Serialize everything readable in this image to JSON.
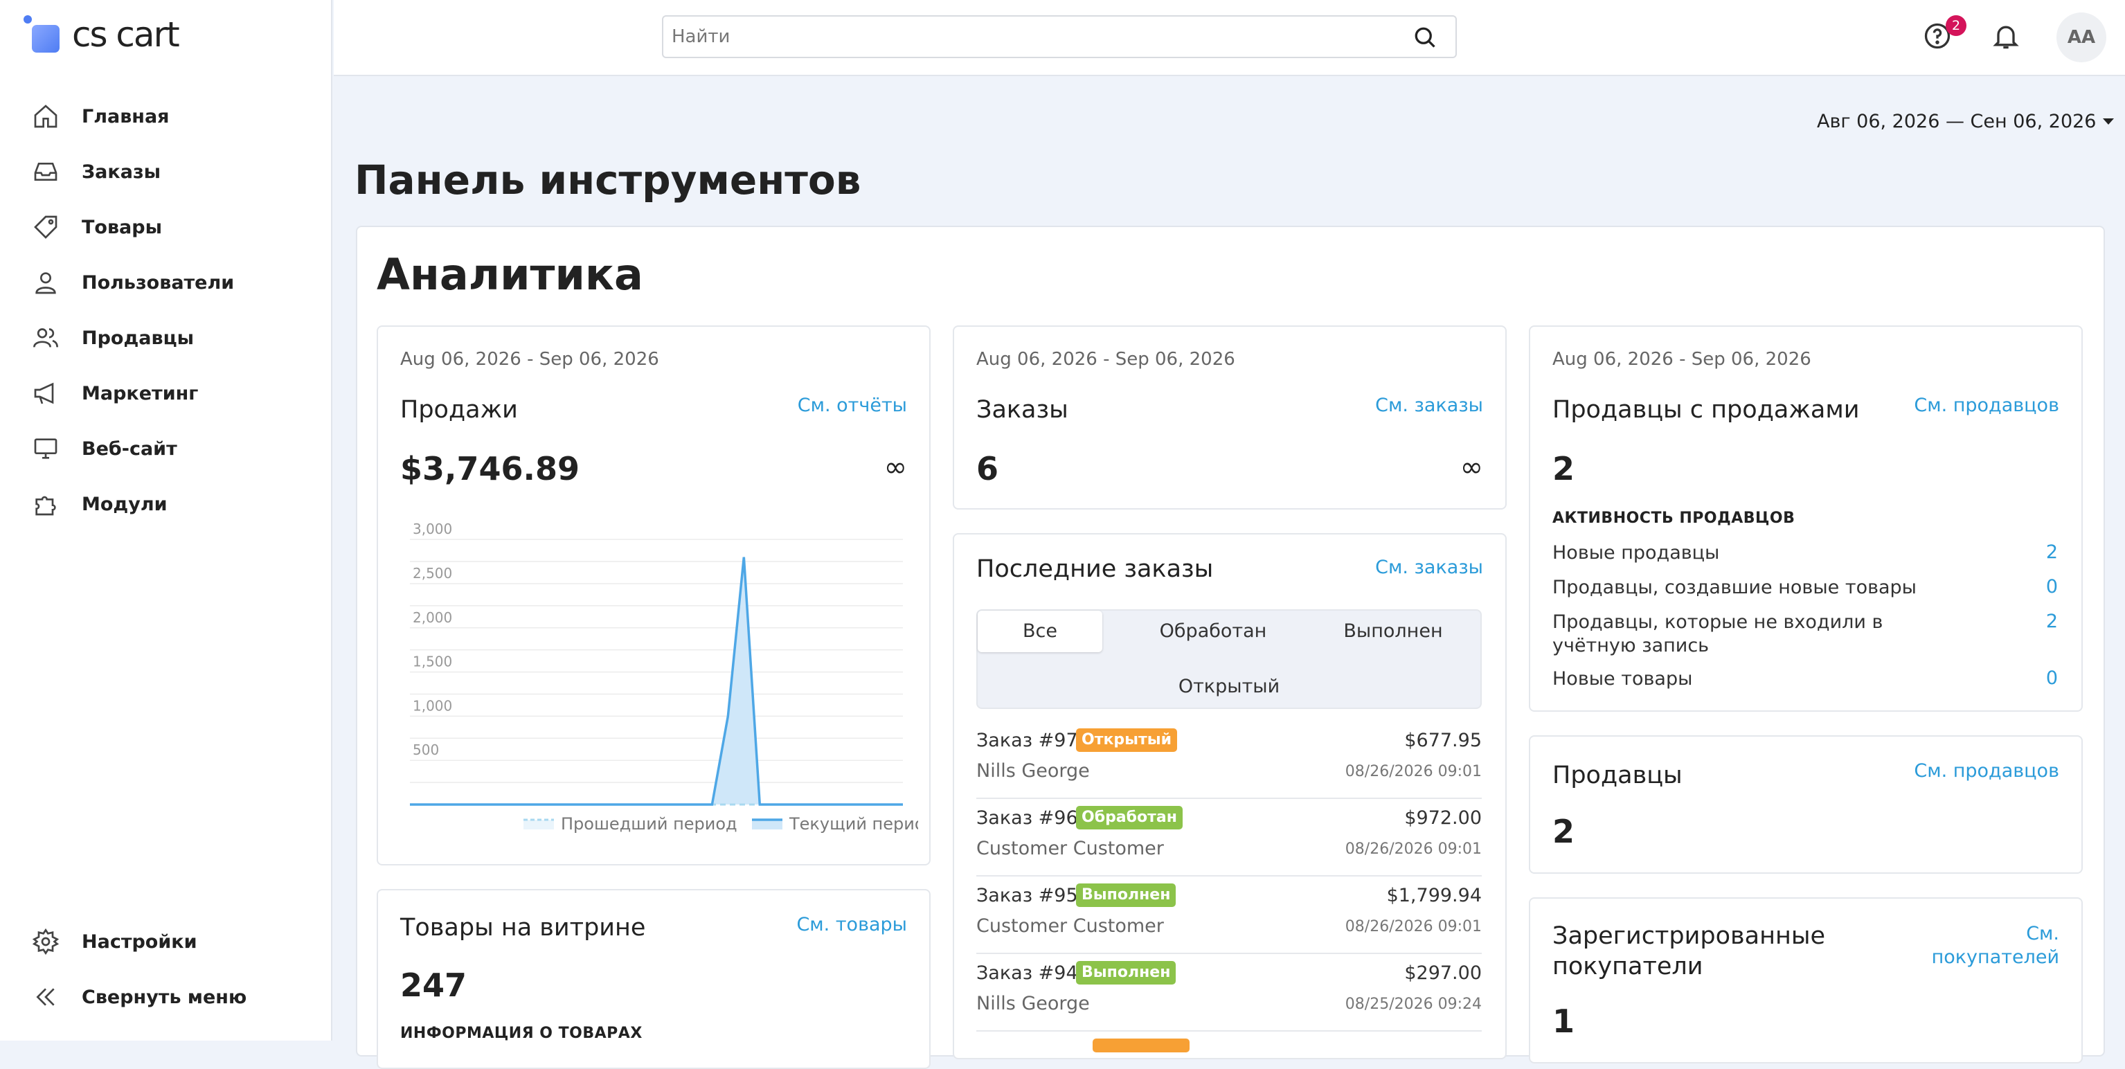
{
  "app": {
    "logo_text": "cs cart"
  },
  "sidebar": {
    "items": [
      {
        "label": "Главная",
        "icon": "home-icon"
      },
      {
        "label": "Заказы",
        "icon": "inbox-icon"
      },
      {
        "label": "Товары",
        "icon": "tag-icon"
      },
      {
        "label": "Пользователи",
        "icon": "user-icon"
      },
      {
        "label": "Продавцы",
        "icon": "users-icon"
      },
      {
        "label": "Маркетинг",
        "icon": "megaphone-icon"
      },
      {
        "label": "Веб-сайт",
        "icon": "monitor-icon"
      },
      {
        "label": "Модули",
        "icon": "puzzle-icon"
      }
    ],
    "settings_label": "Настройки",
    "collapse_label": "Свернуть меню"
  },
  "topbar": {
    "search_placeholder": "Найти",
    "help_badge": "2",
    "avatar_initials": "AA"
  },
  "page": {
    "date_range": "Авг 06, 2026 — Сен 06, 2026",
    "title": "Панель инструментов",
    "section_title": "Аналитика"
  },
  "sales": {
    "date": "Aug 06, 2026 - Sep 06, 2026",
    "title": "Продажи",
    "link": "См. отчёты",
    "value": "$3,746.89",
    "change": "∞"
  },
  "chart_data": {
    "type": "area",
    "ylim": [
      0,
      3000
    ],
    "yticks": [
      "500",
      "1,000",
      "1,500",
      "2,000",
      "2,500",
      "3,000"
    ],
    "points": 32,
    "series": [
      {
        "name": "Прошедший период",
        "values": [
          0,
          0,
          0,
          0,
          0,
          0,
          0,
          0,
          0,
          0,
          0,
          0,
          0,
          0,
          0,
          0,
          0,
          0,
          0,
          0,
          0,
          0,
          0,
          0,
          0,
          0,
          0,
          0,
          0,
          0,
          0,
          0
        ]
      },
      {
        "name": "Текущий период",
        "values": [
          0,
          0,
          0,
          0,
          0,
          0,
          0,
          0,
          0,
          0,
          0,
          0,
          0,
          0,
          0,
          0,
          0,
          0,
          0,
          0,
          1000,
          2800,
          0,
          0,
          0,
          0,
          0,
          0,
          0,
          0,
          0,
          0
        ]
      }
    ],
    "colors": {
      "past": "#a8d8f0",
      "current": "#4ea7e6",
      "fill": "#cfe7f9"
    }
  },
  "orders": {
    "date": "Aug 06, 2026 - Sep 06, 2026",
    "title": "Заказы",
    "link": "См. заказы",
    "value": "6",
    "change": "∞"
  },
  "recent_orders": {
    "title": "Последние заказы",
    "link": "См. заказы",
    "tabs": [
      "Все",
      "Обработан",
      "Выполнен",
      "Открытый"
    ],
    "rows": [
      {
        "no": "Заказ #97",
        "status": "Открытый",
        "color": "#f7a034",
        "amount": "$677.95",
        "customer": "Nills George",
        "time": "08/26/2026 09:01"
      },
      {
        "no": "Заказ #96",
        "status": "Обработан",
        "color": "#8cc34a",
        "amount": "$972.00",
        "customer": "Customer Customer",
        "time": "08/26/2026 09:01"
      },
      {
        "no": "Заказ #95",
        "status": "Выполнен",
        "color": "#8cc34a",
        "amount": "$1,799.94",
        "customer": "Customer Customer",
        "time": "08/26/2026 09:01"
      },
      {
        "no": "Заказ #94",
        "status": "Выполнен",
        "color": "#8cc34a",
        "amount": "$297.00",
        "customer": "Nills George",
        "time": "08/25/2026 09:24"
      }
    ]
  },
  "vendors_sales": {
    "date": "Aug 06, 2026 - Sep 06, 2026",
    "title": "Продавцы с продажами",
    "link": "См. продавцов",
    "value": "2",
    "activity_title": "АКТИВНОСТЬ ПРОДАВЦОВ",
    "activity": [
      {
        "label": "Новые продавцы",
        "value": "2"
      },
      {
        "label": "Продавцы, создавшие новые товары",
        "value": "0"
      },
      {
        "label": "Продавцы, которые не входили в учётную запись",
        "value": "2"
      },
      {
        "label": "Новые товары",
        "value": "0"
      }
    ]
  },
  "vendors": {
    "title": "Продавцы",
    "link": "См. продавцов",
    "value": "2"
  },
  "customers": {
    "title": "Зарегистрированные покупатели",
    "link": "См. покупателей",
    "value": "1"
  },
  "products": {
    "title": "Товары на витрине",
    "link": "См. товары",
    "value": "247",
    "subtitle": "ИНФОРМАЦИЯ О ТОВАРАХ"
  }
}
